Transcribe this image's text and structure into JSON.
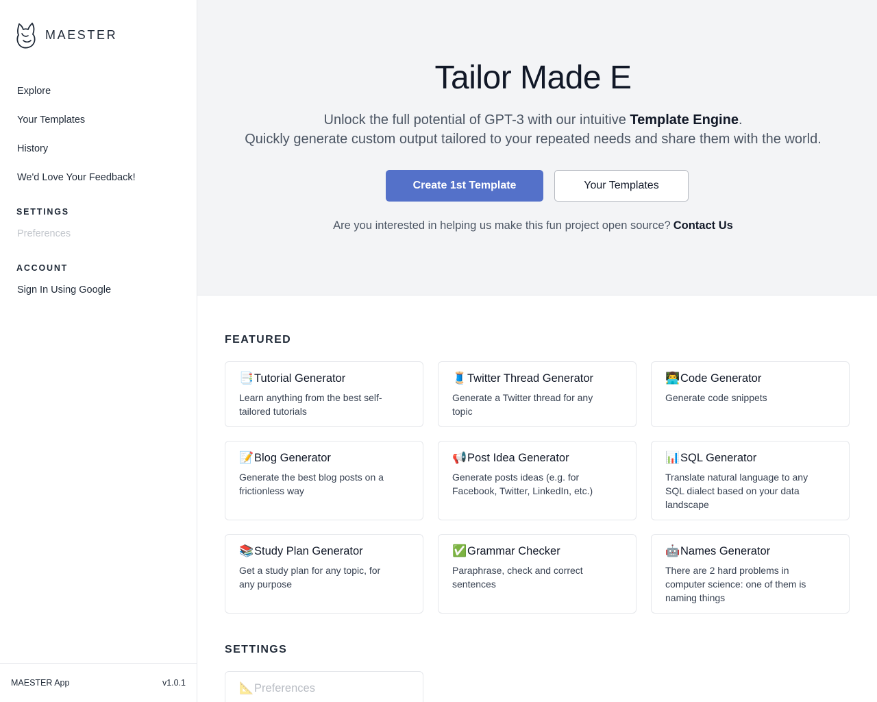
{
  "brand": {
    "name": "MAESTER"
  },
  "sidebar": {
    "nav": [
      {
        "label": "Explore"
      },
      {
        "label": "Your Templates"
      },
      {
        "label": "History"
      },
      {
        "label": "We'd Love Your Feedback!"
      }
    ],
    "settings_heading": "SETTINGS",
    "settings_items": [
      {
        "label": "Preferences",
        "disabled": true
      }
    ],
    "account_heading": "ACCOUNT",
    "account_items": [
      {
        "label": "Sign In Using Google"
      }
    ],
    "footer": {
      "app_name": "MAESTER App",
      "version": "v1.0.1"
    }
  },
  "hero": {
    "title": "Tailor Made E",
    "subtitle_line1_prefix": "Unlock the full potential of GPT-3 with our intuitive ",
    "subtitle_line1_bold": "Template Engine",
    "subtitle_line1_suffix": ".",
    "subtitle_line2": "Quickly generate custom output tailored to your repeated needs and share them with the world.",
    "primary_button": "Create 1st Template",
    "secondary_button": "Your Templates",
    "contact_text": "Are you interested in helping us make this fun project open source?",
    "contact_link": "Contact Us"
  },
  "featured": {
    "heading": "FEATURED",
    "cards": [
      {
        "icon": "📑",
        "title": "Tutorial Generator",
        "desc": "Learn anything from the best self-tailored tutorials"
      },
      {
        "icon": "🧵",
        "title": "Twitter Thread Generator",
        "desc": "Generate a Twitter thread for any topic"
      },
      {
        "icon": "👨‍💻",
        "title": "Code Generator",
        "desc": "Generate code snippets"
      },
      {
        "icon": "📝",
        "title": "Blog Generator",
        "desc": "Generate the best blog posts on a frictionless way"
      },
      {
        "icon": "📢",
        "title": "Post Idea Generator",
        "desc": "Generate posts ideas (e.g. for Facebook, Twitter, LinkedIn, etc.)"
      },
      {
        "icon": "📊",
        "title": "SQL Generator",
        "desc": "Translate natural language to any SQL dialect based on your data landscape"
      },
      {
        "icon": "📚",
        "title": "Study Plan Generator",
        "desc": "Get a study plan for any topic, for any purpose"
      },
      {
        "icon": "✅",
        "title": "Grammar Checker",
        "desc": "Paraphrase, check and correct sentences"
      },
      {
        "icon": "🤖",
        "title": "Names Generator",
        "desc": "There are 2 hard problems in computer science: one of them is naming things"
      }
    ]
  },
  "settings_section": {
    "heading": "SETTINGS",
    "cards": [
      {
        "icon": "📐",
        "title": "Preferences",
        "disabled": true
      }
    ]
  },
  "colors": {
    "primary": "#5471c9",
    "hero_bg": "#f3f4f6",
    "border": "#e5e7eb"
  }
}
